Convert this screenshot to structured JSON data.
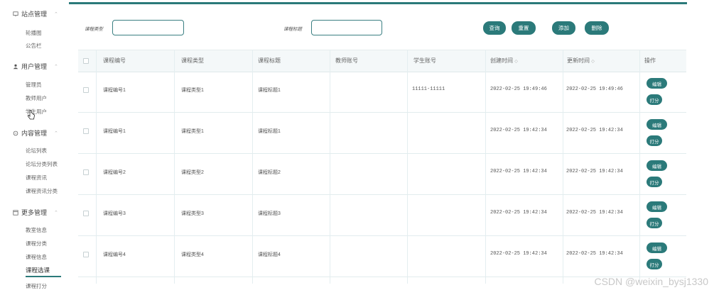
{
  "sidebar": {
    "groups": [
      {
        "title": "站点管理",
        "items": [
          "轮播图",
          "公告栏"
        ]
      },
      {
        "title": "用户管理",
        "items": [
          "管理员",
          "教师用户",
          "学生用户"
        ]
      },
      {
        "title": "内容管理",
        "items": [
          "论坛列表",
          "论坛分类列表",
          "课程资讯",
          "课程资讯分类"
        ]
      },
      {
        "title": "更多管理",
        "items": [
          "教室信息",
          "课程分类",
          "课程信息",
          "课程选课",
          "课程打分"
        ]
      }
    ],
    "active_item": "课程选课"
  },
  "filters": {
    "type_label": "课程类型",
    "type_value": "",
    "title_label": "课程标题",
    "title_value": ""
  },
  "buttons": {
    "search": "查询",
    "reset": "重置",
    "add": "添加",
    "delete": "删除"
  },
  "table": {
    "headers": [
      "课程编号",
      "课程类型",
      "课程标题",
      "教师账号",
      "学生账号",
      "创建时间",
      "更新时间",
      "操作"
    ],
    "sort_marker": "◇",
    "rows": [
      {
        "code": "课程编号1",
        "type": "课程类型1",
        "title": "课程标题1",
        "teacher": "",
        "student": "11111-11111",
        "created": "2022-02-25 19:49:46",
        "updated": "2022-02-25 19:49:46"
      },
      {
        "code": "课程编号1",
        "type": "课程类型1",
        "title": "课程标题1",
        "teacher": "",
        "student": "",
        "created": "2022-02-25 19:42:34",
        "updated": "2022-02-25 19:42:34"
      },
      {
        "code": "课程编号2",
        "type": "课程类型2",
        "title": "课程标题2",
        "teacher": "",
        "student": "",
        "created": "2022-02-25 19:42:34",
        "updated": "2022-02-25 19:42:34"
      },
      {
        "code": "课程编号3",
        "type": "课程类型3",
        "title": "课程标题3",
        "teacher": "",
        "student": "",
        "created": "2022-02-25 19:42:34",
        "updated": "2022-02-25 19:42:34"
      },
      {
        "code": "课程编号4",
        "type": "课程类型4",
        "title": "课程标题4",
        "teacher": "",
        "student": "",
        "created": "2022-02-25 19:42:34",
        "updated": "2022-02-25 19:42:34"
      }
    ],
    "row_actions": {
      "edit": "编辑",
      "score": "打分"
    }
  },
  "watermark": "CSDN @weixin_bysj1330",
  "colors": {
    "accent": "#2b7a7a",
    "header_bg": "#f4f8f9"
  }
}
